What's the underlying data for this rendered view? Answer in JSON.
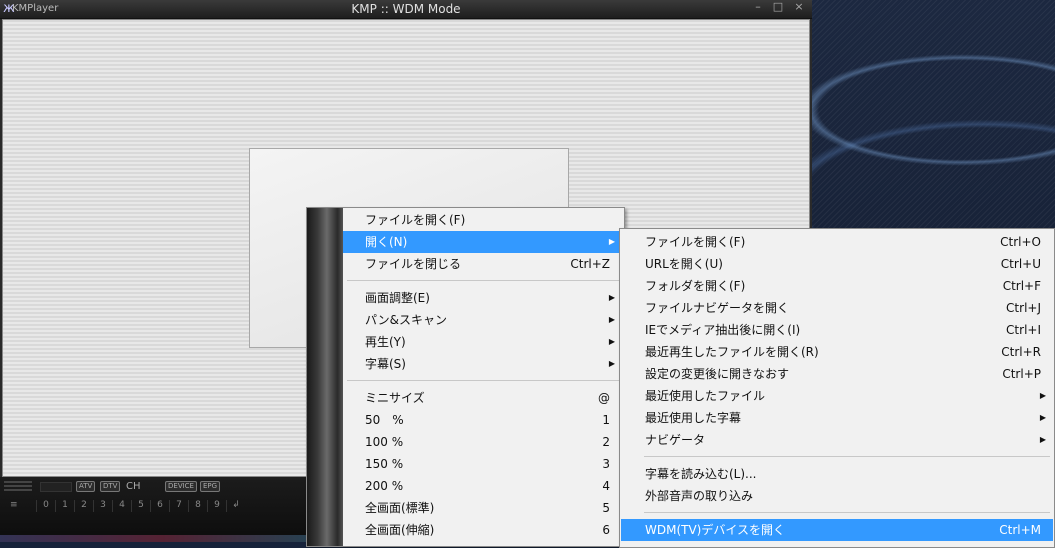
{
  "window": {
    "app_name": "KMPlayer",
    "title": "KMP :: WDM Mode",
    "logo_glyph": "ж",
    "minimize_glyph": "–",
    "maximize_glyph": "□",
    "close_glyph": "×"
  },
  "controls": {
    "atv": "ATV",
    "dtv": "DTV",
    "ch": "CH",
    "device": "DEVICE",
    "epg": "EPG",
    "channels": [
      "0",
      "1",
      "2",
      "3",
      "4",
      "5",
      "6",
      "7",
      "8",
      "9"
    ],
    "enter_glyph": "↲"
  },
  "main_menu": {
    "open_file": "ファイルを開く(F)",
    "open": "開く(N)",
    "close_file": "ファイルを閉じる",
    "close_file_shortcut": "Ctrl+Z",
    "screen_adjust": "画面調整(E)",
    "pan_scan": "パン&スキャン",
    "playback": "再生(Y)",
    "subtitles": "字幕(S)",
    "mini_size": "ミニサイズ",
    "mini_size_shortcut": "@",
    "size_50": "50　%",
    "size_50_shortcut": "1",
    "size_100": "100 %",
    "size_100_shortcut": "2",
    "size_150": "150 %",
    "size_150_shortcut": "3",
    "size_200": "200 %",
    "size_200_shortcut": "4",
    "fullscreen_std": "全画面(標準)",
    "fullscreen_std_shortcut": "5",
    "fullscreen_stretch": "全画面(伸縮)",
    "fullscreen_stretch_shortcut": "6",
    "submenu_arrow": "▶"
  },
  "open_submenu": {
    "open_file": "ファイルを開く(F)",
    "open_file_shortcut": "Ctrl+O",
    "open_url": "URLを開く(U)",
    "open_url_shortcut": "Ctrl+U",
    "open_folder": "フォルダを開く(F)",
    "open_folder_shortcut": "Ctrl+F",
    "open_file_navigator": "ファイルナビゲータを開く",
    "open_file_navigator_shortcut": "Ctrl+J",
    "ie_media_extract": "IEでメディア抽出後に開く(I)",
    "ie_media_extract_shortcut": "Ctrl+I",
    "open_recent_played": "最近再生したファイルを開く(R)",
    "open_recent_played_shortcut": "Ctrl+R",
    "reopen_after_settings": "設定の変更後に開きなおす",
    "reopen_after_settings_shortcut": "Ctrl+P",
    "recent_files": "最近使用したファイル",
    "recent_subtitles": "最近使用した字幕",
    "navigator": "ナビゲータ",
    "load_subtitles": "字幕を読み込む(L)...",
    "load_external_audio": "外部音声の取り込み",
    "open_wdm_device": "WDM(TV)デバイスを開く",
    "open_wdm_device_shortcut": "Ctrl+M"
  }
}
